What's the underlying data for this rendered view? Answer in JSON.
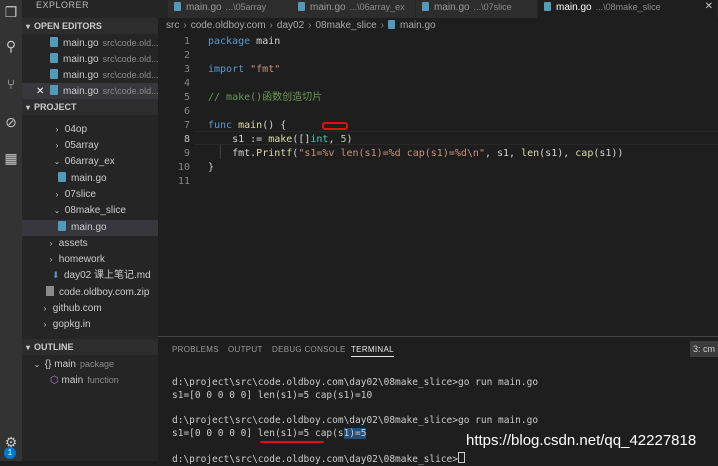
{
  "sidebar": {
    "title": "EXPLORER",
    "open_editors_label": "OPEN EDITORS",
    "open_editors": [
      {
        "name": "main.go",
        "path": "src\\code.old..."
      },
      {
        "name": "main.go",
        "path": "src\\code.old..."
      },
      {
        "name": "main.go",
        "path": "src\\code.old..."
      },
      {
        "name": "main.go",
        "path": "src\\code.old..."
      }
    ],
    "project_label": "PROJECT",
    "tree": [
      {
        "label": "04op",
        "kind": "folder"
      },
      {
        "label": "05array",
        "kind": "folder"
      },
      {
        "label": "06array_ex",
        "kind": "folder-open"
      },
      {
        "label": "main.go",
        "kind": "go"
      },
      {
        "label": "07slice",
        "kind": "folder"
      },
      {
        "label": "08make_slice",
        "kind": "folder-open"
      },
      {
        "label": "main.go",
        "kind": "go"
      },
      {
        "label": "assets",
        "kind": "folder"
      },
      {
        "label": "homework",
        "kind": "folder"
      },
      {
        "label": "day02 课上笔记.md",
        "kind": "md"
      },
      {
        "label": "code.oldboy.com.zip",
        "kind": "zip"
      },
      {
        "label": "github.com",
        "kind": "folder"
      },
      {
        "label": "gopkg.in",
        "kind": "folder"
      }
    ],
    "outline_label": "OUTLINE",
    "outline": [
      {
        "label": "main",
        "kind": "package"
      },
      {
        "label": "main",
        "kind": "function"
      }
    ],
    "badge": "1"
  },
  "tabs": [
    {
      "name": "main.go",
      "path": "...\\05array"
    },
    {
      "name": "main.go",
      "path": "...\\06array_ex"
    },
    {
      "name": "main.go",
      "path": "...\\07slice"
    },
    {
      "name": "main.go",
      "path": "...\\08make_slice",
      "active": true
    }
  ],
  "breadcrumb": [
    "src",
    "code.oldboy.com",
    "day02",
    "08make_slice",
    "main.go"
  ],
  "editor": {
    "line_numbers": [
      "1",
      "2",
      "3",
      "4",
      "5",
      "6",
      "7",
      "8",
      "9",
      "10",
      "11"
    ],
    "code": {
      "l1_kw": "package",
      "l1_id": " main",
      "l3_kw": "import",
      "l3_str": " \"fmt\"",
      "l5_comment": "// make()函数创造切片",
      "l7_kw": "func",
      "l7_fn": " main",
      "l7_rest": "() {",
      "l8_a": "    s1 := ",
      "l8_fn": "make",
      "l8_b": "([]",
      "l8_ty": "int",
      "l8_c": ", ",
      "l8_num": "5",
      "l8_d": ")",
      "l9_a": "    fmt.",
      "l9_fn": "Printf",
      "l9_b": "(",
      "l9_str": "\"s1=%v len(s1)=%d cap(s1)=%d\\n\"",
      "l9_c": ", s1, ",
      "l9_len": "len",
      "l9_d": "(s1), ",
      "l9_cap": "cap",
      "l9_e": "(s1))",
      "l10": "}"
    }
  },
  "panel": {
    "tabs": [
      "PROBLEMS",
      "OUTPUT",
      "DEBUG CONSOLE",
      "TERMINAL"
    ],
    "active_tab": "TERMINAL",
    "terminal_select": "3: cm",
    "lines": {
      "cmd1": "d:\\project\\src\\code.oldboy.com\\day02\\08make_slice>go run main.go",
      "out1": "s1=[0 0 0 0 0] len(s1)=5 cap(s1)=10",
      "cmd2": "d:\\project\\src\\code.oldboy.com\\day02\\08make_slice>go run main.go",
      "out2_pre": "s1=[0 0 0 0 0] len(s1)=5 cap(s",
      "out2_hl": "1)=5",
      "cmd3": "d:\\project\\src\\code.oldboy.com\\day02\\08make_slice>"
    }
  },
  "watermark": "https://blog.csdn.net/qq_42227818",
  "colors": {
    "accent": "#007acc",
    "annotation": "#e01010"
  }
}
